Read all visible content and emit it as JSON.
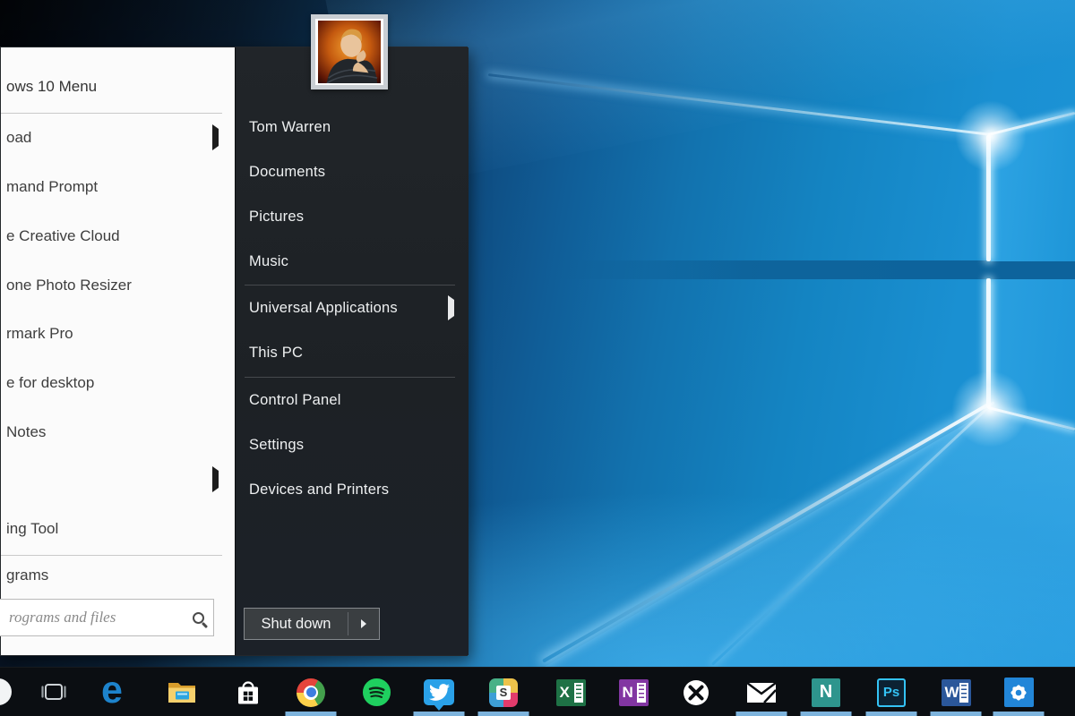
{
  "start_menu": {
    "left_panel": {
      "header": "ows 10 Menu",
      "items": [
        {
          "label": "oad",
          "arrow": true
        },
        {
          "label": "mand Prompt",
          "arrow": false
        },
        {
          "label": "e Creative Cloud",
          "arrow": false
        },
        {
          "label": "one Photo Resizer",
          "arrow": false
        },
        {
          "label": "rmark Pro",
          "arrow": false
        },
        {
          "label": "e for desktop",
          "arrow": false
        },
        {
          "label": "Notes",
          "arrow": false
        },
        {
          "label": "",
          "arrow": true
        },
        {
          "label": "ing Tool",
          "arrow": false
        }
      ],
      "programs_label": "grams",
      "search_placeholder": "rograms and files"
    },
    "right_panel": {
      "user_name": "Tom Warren",
      "items": [
        {
          "label": "Documents"
        },
        {
          "label": "Pictures"
        },
        {
          "label": "Music"
        },
        {
          "label": "Universal Applications",
          "arrow": true
        },
        {
          "label": "This PC"
        },
        {
          "label": "Control Panel"
        },
        {
          "label": "Settings"
        },
        {
          "label": "Devices and Printers"
        }
      ],
      "shutdown_label": "Shut down"
    }
  },
  "taskbar": {
    "icons": [
      {
        "name": "start-button",
        "running": false
      },
      {
        "name": "task-view",
        "running": false
      },
      {
        "name": "microsoft-edge",
        "glyph": "e",
        "running": false
      },
      {
        "name": "file-explorer",
        "running": false
      },
      {
        "name": "windows-store",
        "running": false
      },
      {
        "name": "chrome",
        "running": true
      },
      {
        "name": "spotify",
        "running": false
      },
      {
        "name": "twitter",
        "running": true
      },
      {
        "name": "slack",
        "glyph": "S",
        "running": true
      },
      {
        "name": "excel",
        "glyph": "X",
        "running": false
      },
      {
        "name": "onenote",
        "glyph": "N",
        "running": false
      },
      {
        "name": "xbox",
        "running": false
      },
      {
        "name": "mail",
        "running": true
      },
      {
        "name": "nextgen-reader",
        "glyph": "N",
        "running": true
      },
      {
        "name": "photoshop",
        "glyph": "Ps",
        "running": true
      },
      {
        "name": "word",
        "glyph": "W",
        "running": true
      },
      {
        "name": "settings",
        "running": true
      }
    ]
  },
  "colors": {
    "wallpaper_blue": "#1484c2",
    "taskbar_bg": "#0b0e12",
    "taskbar_underline": "#7db3dc",
    "menu_dark_bg": "#1f2327",
    "menu_light_bg": "#fbfbfb",
    "shutdown_bg": "#3a3e41"
  }
}
